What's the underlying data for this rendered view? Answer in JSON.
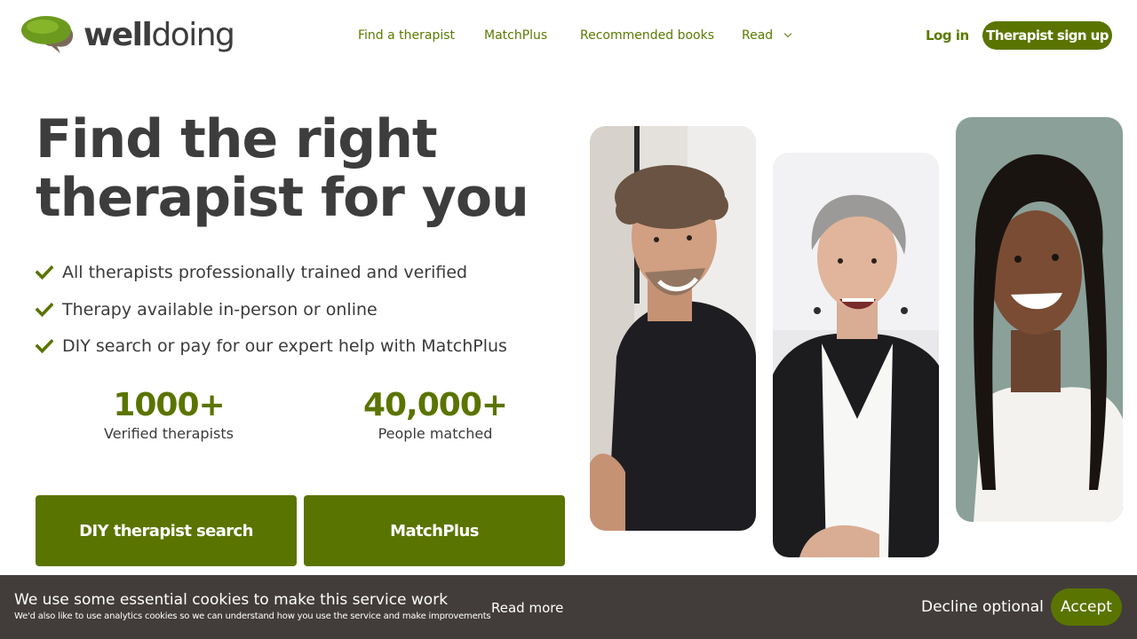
{
  "header": {
    "logo_text_bold": "well",
    "logo_text_regular": "doing",
    "nav": {
      "find_therapist": "Find a therapist",
      "matchplus": "MatchPlus",
      "recommended_books": "Recommended books",
      "read": "Read"
    },
    "login": "Log in",
    "signup": "Therapist sign up"
  },
  "hero": {
    "title_line1": "Find the right",
    "title_line2": "therapist for you",
    "features": [
      "All therapists professionally trained and verified",
      "Therapy available in-person or online",
      "DIY search or pay for our expert help with MatchPlus"
    ],
    "stats": [
      {
        "value": "1000+",
        "label": "Verified therapists"
      },
      {
        "value": "40,000+",
        "label": "People matched"
      }
    ],
    "cta_diy": "DIY therapist search",
    "cta_matchplus": "MatchPlus"
  },
  "cookie": {
    "title": "We use some essential cookies to make this service work",
    "subtitle": "We'd also like to use analytics cookies so we can understand how you use the service and make improvements",
    "read_more": "Read more",
    "decline": "Decline optional",
    "accept": "Accept"
  },
  "colors": {
    "brand_green": "#5a7400",
    "text_dark": "#3d3d3d",
    "cookie_bg": "#423d3a"
  }
}
